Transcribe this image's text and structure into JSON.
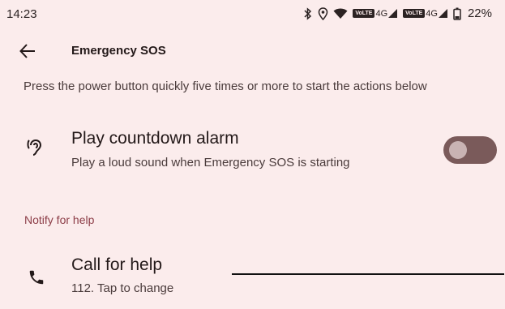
{
  "status_bar": {
    "time": "14:23",
    "volte1": "VoLTE",
    "net1": "4G",
    "volte2": "VoLTE",
    "net2": "4G",
    "battery": "22%"
  },
  "app_bar": {
    "title": "Emergency SOS",
    "back_icon": "arrow-back-icon"
  },
  "description": "Press the power button quickly five times or more to start the actions below",
  "alarm_setting": {
    "icon": "hearing-icon",
    "title": "Play countdown alarm",
    "subtitle": "Play a loud sound when Emergency SOS is starting",
    "enabled": false
  },
  "section_header": "Notify for help",
  "call_setting": {
    "icon": "phone-icon",
    "title": "Call for help",
    "subtitle": "112. Tap to change"
  },
  "colors": {
    "background": "#fbecec",
    "accent": "#8c3d47",
    "toggle_track": "#7a5a5a",
    "toggle_thumb": "#c9b3b3"
  }
}
